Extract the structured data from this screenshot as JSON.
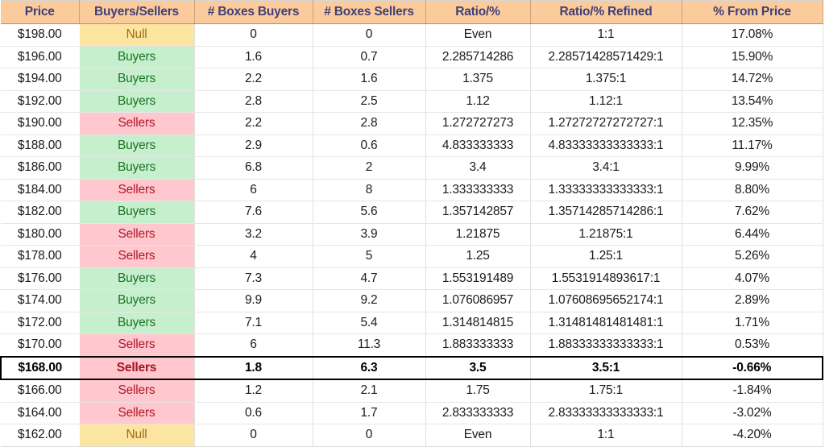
{
  "table": {
    "columns": [
      {
        "key": "price",
        "label": "Price"
      },
      {
        "key": "status",
        "label": "Buyers/Sellers"
      },
      {
        "key": "boxes_buyers",
        "label": "# Boxes Buyers"
      },
      {
        "key": "boxes_sellers",
        "label": "# Boxes Sellers"
      },
      {
        "key": "ratio",
        "label": "Ratio/%"
      },
      {
        "key": "ratio_refined",
        "label": "Ratio/% Refined"
      },
      {
        "key": "pct_from_price",
        "label": "% From Price"
      }
    ],
    "colors": {
      "header_bg": "#FBCB9C",
      "header_text": "#3F3F76",
      "buyers_bg": "#C6EFCE",
      "buyers_text": "#1D7324",
      "sellers_bg": "#FFC7CE",
      "sellers_text": "#B01828",
      "null_bg": "#FCE5A1",
      "null_text": "#9C6A14",
      "focus_border": "#000000"
    },
    "highlighted_row_price": "$168.00",
    "rows": [
      {
        "price": "$198.00",
        "status": "Null",
        "boxes_buyers": "0",
        "boxes_sellers": "0",
        "ratio": "Even",
        "ratio_refined": "1:1",
        "pct_from_price": "17.08%",
        "highlight": false
      },
      {
        "price": "$196.00",
        "status": "Buyers",
        "boxes_buyers": "1.6",
        "boxes_sellers": "0.7",
        "ratio": "2.285714286",
        "ratio_refined": "2.28571428571429:1",
        "pct_from_price": "15.90%",
        "highlight": false
      },
      {
        "price": "$194.00",
        "status": "Buyers",
        "boxes_buyers": "2.2",
        "boxes_sellers": "1.6",
        "ratio": "1.375",
        "ratio_refined": "1.375:1",
        "pct_from_price": "14.72%",
        "highlight": false
      },
      {
        "price": "$192.00",
        "status": "Buyers",
        "boxes_buyers": "2.8",
        "boxes_sellers": "2.5",
        "ratio": "1.12",
        "ratio_refined": "1.12:1",
        "pct_from_price": "13.54%",
        "highlight": false
      },
      {
        "price": "$190.00",
        "status": "Sellers",
        "boxes_buyers": "2.2",
        "boxes_sellers": "2.8",
        "ratio": "1.272727273",
        "ratio_refined": "1.27272727272727:1",
        "pct_from_price": "12.35%",
        "highlight": false
      },
      {
        "price": "$188.00",
        "status": "Buyers",
        "boxes_buyers": "2.9",
        "boxes_sellers": "0.6",
        "ratio": "4.833333333",
        "ratio_refined": "4.83333333333333:1",
        "pct_from_price": "11.17%",
        "highlight": false
      },
      {
        "price": "$186.00",
        "status": "Buyers",
        "boxes_buyers": "6.8",
        "boxes_sellers": "2",
        "ratio": "3.4",
        "ratio_refined": "3.4:1",
        "pct_from_price": "9.99%",
        "highlight": false
      },
      {
        "price": "$184.00",
        "status": "Sellers",
        "boxes_buyers": "6",
        "boxes_sellers": "8",
        "ratio": "1.333333333",
        "ratio_refined": "1.33333333333333:1",
        "pct_from_price": "8.80%",
        "highlight": false
      },
      {
        "price": "$182.00",
        "status": "Buyers",
        "boxes_buyers": "7.6",
        "boxes_sellers": "5.6",
        "ratio": "1.357142857",
        "ratio_refined": "1.35714285714286:1",
        "pct_from_price": "7.62%",
        "highlight": false
      },
      {
        "price": "$180.00",
        "status": "Sellers",
        "boxes_buyers": "3.2",
        "boxes_sellers": "3.9",
        "ratio": "1.21875",
        "ratio_refined": "1.21875:1",
        "pct_from_price": "6.44%",
        "highlight": false
      },
      {
        "price": "$178.00",
        "status": "Sellers",
        "boxes_buyers": "4",
        "boxes_sellers": "5",
        "ratio": "1.25",
        "ratio_refined": "1.25:1",
        "pct_from_price": "5.26%",
        "highlight": false
      },
      {
        "price": "$176.00",
        "status": "Buyers",
        "boxes_buyers": "7.3",
        "boxes_sellers": "4.7",
        "ratio": "1.553191489",
        "ratio_refined": "1.5531914893617:1",
        "pct_from_price": "4.07%",
        "highlight": false
      },
      {
        "price": "$174.00",
        "status": "Buyers",
        "boxes_buyers": "9.9",
        "boxes_sellers": "9.2",
        "ratio": "1.076086957",
        "ratio_refined": "1.07608695652174:1",
        "pct_from_price": "2.89%",
        "highlight": false
      },
      {
        "price": "$172.00",
        "status": "Buyers",
        "boxes_buyers": "7.1",
        "boxes_sellers": "5.4",
        "ratio": "1.314814815",
        "ratio_refined": "1.31481481481481:1",
        "pct_from_price": "1.71%",
        "highlight": false
      },
      {
        "price": "$170.00",
        "status": "Sellers",
        "boxes_buyers": "6",
        "boxes_sellers": "11.3",
        "ratio": "1.883333333",
        "ratio_refined": "1.88333333333333:1",
        "pct_from_price": "0.53%",
        "highlight": false
      },
      {
        "price": "$168.00",
        "status": "Sellers",
        "boxes_buyers": "1.8",
        "boxes_sellers": "6.3",
        "ratio": "3.5",
        "ratio_refined": "3.5:1",
        "pct_from_price": "-0.66%",
        "highlight": true
      },
      {
        "price": "$166.00",
        "status": "Sellers",
        "boxes_buyers": "1.2",
        "boxes_sellers": "2.1",
        "ratio": "1.75",
        "ratio_refined": "1.75:1",
        "pct_from_price": "-1.84%",
        "highlight": false
      },
      {
        "price": "$164.00",
        "status": "Sellers",
        "boxes_buyers": "0.6",
        "boxes_sellers": "1.7",
        "ratio": "2.833333333",
        "ratio_refined": "2.83333333333333:1",
        "pct_from_price": "-3.02%",
        "highlight": false
      },
      {
        "price": "$162.00",
        "status": "Null",
        "boxes_buyers": "0",
        "boxes_sellers": "0",
        "ratio": "Even",
        "ratio_refined": "1:1",
        "pct_from_price": "-4.20%",
        "highlight": false
      }
    ]
  }
}
